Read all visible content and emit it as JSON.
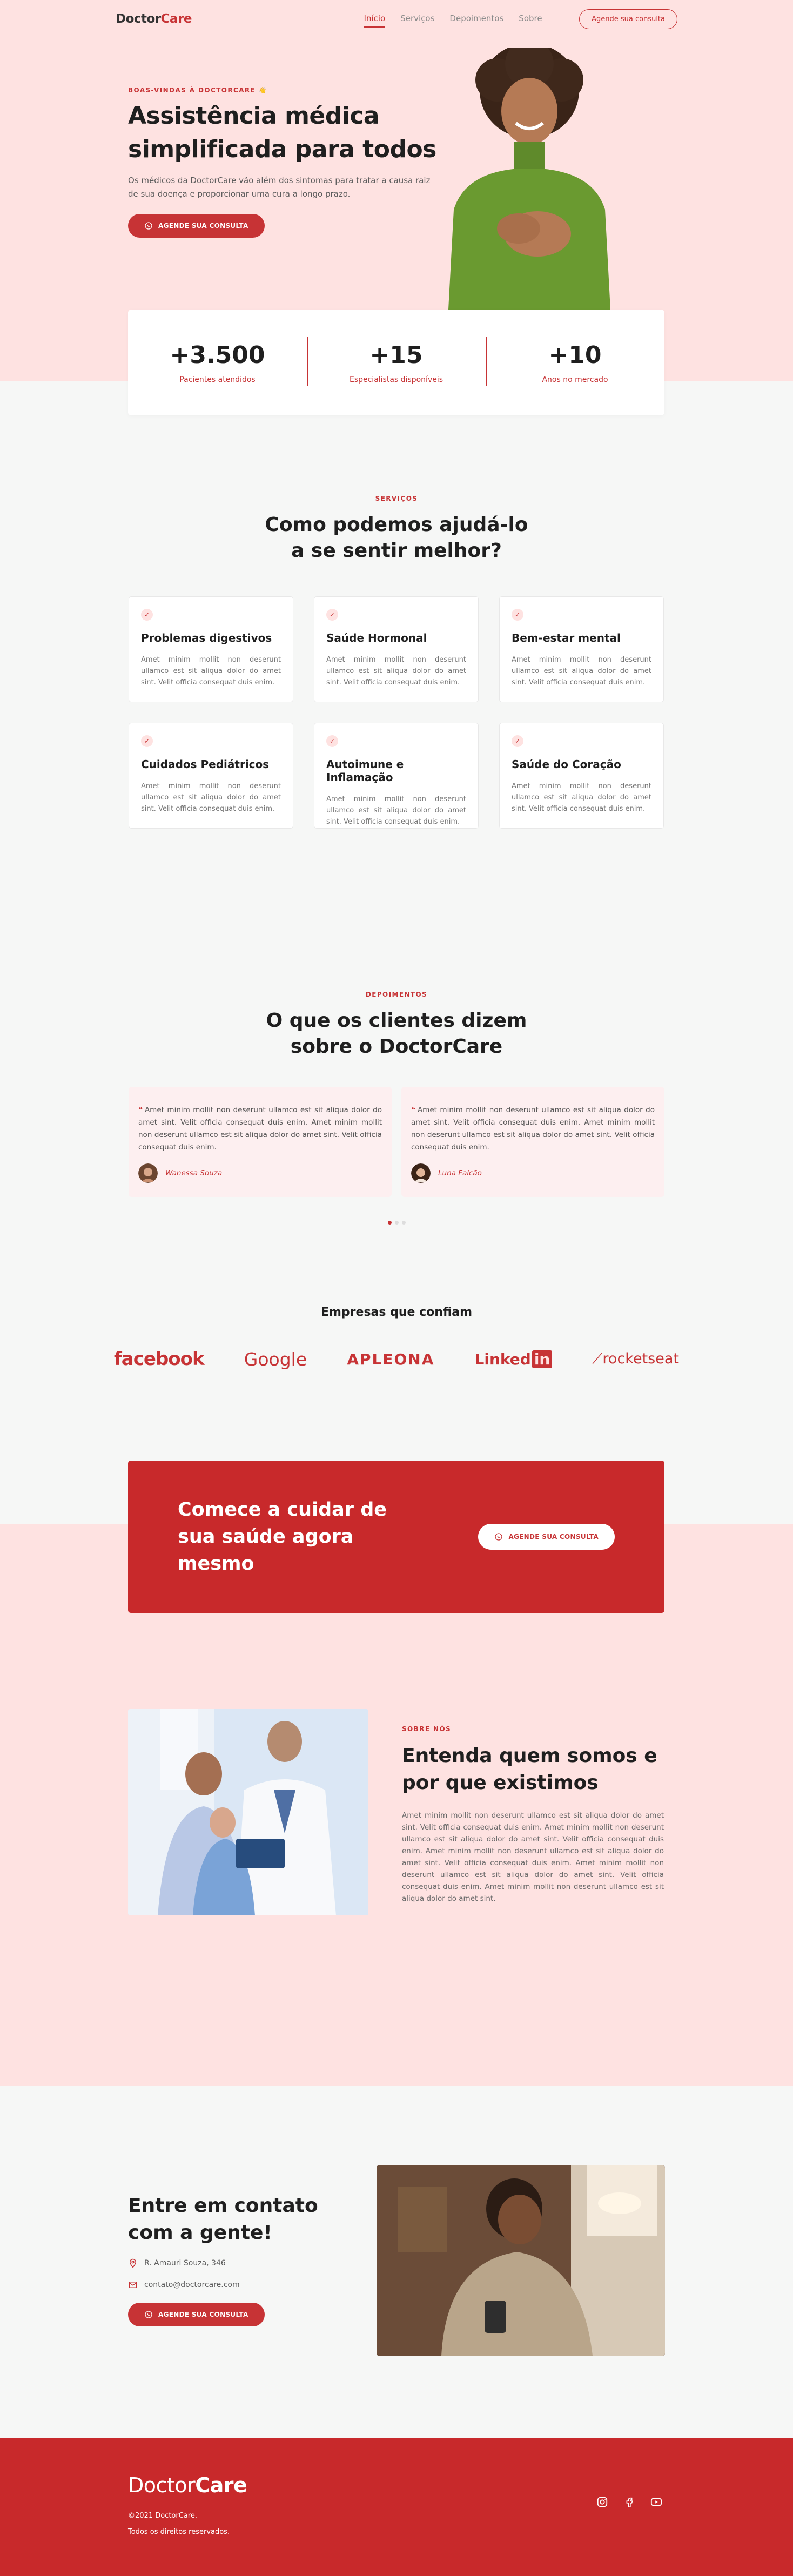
{
  "header": {
    "logo_prefix": "Doctor",
    "logo_accent": "Care",
    "nav": [
      "Início",
      "Serviços",
      "Depoimentos",
      "Sobre"
    ],
    "cta_label": "Agende sua consulta"
  },
  "hero": {
    "eyebrow": "Boas-vindas à DoctorCare 👋",
    "title_line1": "Assistência médica",
    "title_line2": "simplificada para todos",
    "subtitle": "Os médicos da DoctorCare vão além dos sintomas para tratar a causa raiz de sua doença e proporcionar uma cura a longo prazo.",
    "button": "Agende sua consulta"
  },
  "stats": [
    {
      "value": "+3.500",
      "label": "Pacientes atendidos"
    },
    {
      "value": "+15",
      "label": "Especialistas disponíveis"
    },
    {
      "value": "+10",
      "label": "Anos no mercado"
    }
  ],
  "services": {
    "eyebrow": "Serviços",
    "title_line1": "Como podemos ajudá-lo",
    "title_line2": "a se sentir melhor?",
    "items": [
      {
        "title": "Problemas digestivos",
        "text": "Amet minim mollit non deserunt ullamco est sit aliqua dolor do amet sint. Velit officia consequat duis enim."
      },
      {
        "title": "Saúde Hormonal",
        "text": "Amet minim mollit non deserunt ullamco est sit aliqua dolor do amet sint. Velit officia consequat duis enim."
      },
      {
        "title": "Bem-estar mental",
        "text": "Amet minim mollit non deserunt ullamco est sit aliqua dolor do amet sint. Velit officia consequat duis enim."
      },
      {
        "title": "Cuidados Pediátricos",
        "text": "Amet minim mollit non deserunt ullamco est sit aliqua dolor do amet sint. Velit officia consequat duis enim."
      },
      {
        "title": "Autoimune e Inflamação",
        "text": "Amet minim mollit non deserunt ullamco est sit aliqua dolor do amet sint. Velit officia consequat duis enim."
      },
      {
        "title": "Saúde do Coração",
        "text": "Amet minim mollit non deserunt ullamco est sit aliqua dolor do amet sint. Velit officia consequat duis enim."
      }
    ]
  },
  "testimonials": {
    "eyebrow": "Depoimentos",
    "title_line1": "O que os clientes dizem",
    "title_line2": "sobre o DoctorCare",
    "items": [
      {
        "quote": "Amet minim mollit non deserunt ullamco est sit aliqua dolor do amet sint. Velit officia consequat duis enim. Amet minim mollit non deserunt ullamco est sit aliqua dolor do amet sint. Velit officia consequat duis enim.",
        "author": "Wanessa Souza"
      },
      {
        "quote": "Amet minim mollit non deserunt ullamco est sit aliqua dolor do amet sint. Velit officia consequat duis enim. Amet minim mollit non deserunt ullamco est sit aliqua dolor do amet sint. Velit officia consequat duis enim.",
        "author": "Luna Falcão"
      }
    ]
  },
  "partners": {
    "title": "Empresas que confiam",
    "logos": [
      "facebook",
      "Google",
      "APLEONA",
      "Linked",
      "in",
      "rocketseat"
    ]
  },
  "cta": {
    "title": "Comece a cuidar de sua saúde agora mesmo",
    "button": "Agende sua consulta"
  },
  "about": {
    "eyebrow": "Sobre nós",
    "title": "Entenda quem somos e por que existimos",
    "text": "Amet minim mollit non deserunt ullamco est sit aliqua dolor do amet sint. Velit officia consequat duis enim. Amet minim mollit non deserunt ullamco est sit aliqua dolor do amet sint. Velit officia consequat duis enim. Amet minim mollit non deserunt ullamco est sit aliqua dolor do amet sint. Velit officia consequat duis enim. Amet minim mollit non deserunt ullamco est sit aliqua dolor do amet sint. Velit officia consequat duis enim. Amet minim mollit non deserunt ullamco est sit aliqua dolor do amet sint."
  },
  "contact": {
    "title": "Entre em contato com a gente!",
    "address": "R. Amauri Souza, 346",
    "email": "contato@doctorcare.com",
    "button": "Agende sua consulta"
  },
  "footer": {
    "logo_prefix": "Doctor",
    "logo_accent": "Care",
    "copyright": "©2021 DoctorCare.",
    "rights": "Todos os direitos reservados.",
    "social": [
      "instagram-icon",
      "facebook-icon",
      "youtube-icon"
    ]
  },
  "colors": {
    "brand": "#c73335",
    "pink_bg": "#fee2e1",
    "light_bg": "#f6f7f6"
  }
}
